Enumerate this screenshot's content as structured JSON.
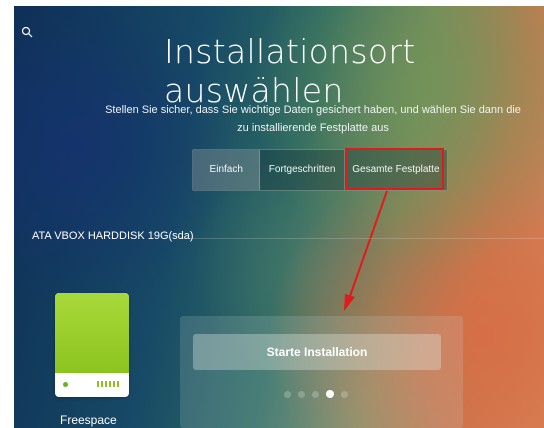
{
  "page": {
    "title": "Installationsort auswählen",
    "subtitle_line1": "Stellen Sie sicher, dass Sie wichtige Daten gesichert haben, und wählen Sie dann die",
    "subtitle_line2": "zu installierende Festplatte aus"
  },
  "tabs": [
    {
      "label": "Einfach",
      "active": true
    },
    {
      "label": "Fortgeschritten",
      "active": false
    },
    {
      "label": "Gesamte Festplatte",
      "active": false,
      "highlighted": true
    }
  ],
  "disk": {
    "name": "ATA VBOX HARDDISK 19G(sda)",
    "partition_label": "Freespace",
    "color": "#9acd32"
  },
  "actions": {
    "start_label": "Starte Installation"
  },
  "pagination": {
    "count": 5,
    "active_index": 3
  },
  "annotation": {
    "color": "#e11a1a"
  },
  "icons": {
    "search": "search-icon",
    "drive": "hard-drive-icon"
  }
}
